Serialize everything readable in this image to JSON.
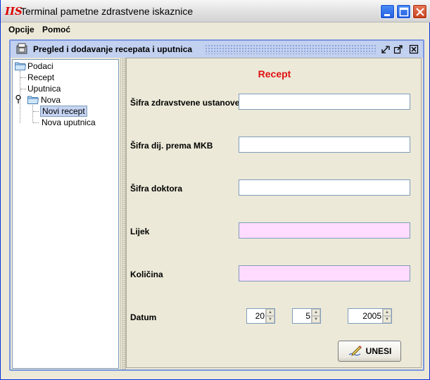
{
  "window": {
    "title": "Terminal pametne zdrastvene iskaznice",
    "app_icon_text": "IIS",
    "controls": [
      "minimize",
      "maximize",
      "close"
    ]
  },
  "menu": {
    "items": [
      "Opcije",
      "Pomoć"
    ]
  },
  "internal_frame": {
    "title": "Pregled i dodavanje recepata i uputnica"
  },
  "tree": {
    "root": "Podaci",
    "items": [
      "Recept",
      "Uputnica"
    ],
    "group": "Nova",
    "group_items": [
      "Novi recept",
      "Nova uputnica"
    ],
    "selected": "Novi recept"
  },
  "form": {
    "title": "Recept",
    "fields": [
      {
        "label": "Šifra zdravstvene ustanove",
        "value": ""
      },
      {
        "label": "Šifra dij. prema MKB",
        "value": ""
      },
      {
        "label": "Šifra doktora",
        "value": ""
      },
      {
        "label": "Lijek",
        "value": ""
      },
      {
        "label": "Količina",
        "value": ""
      }
    ],
    "date": {
      "label": "Datum",
      "day": "20",
      "month": "5",
      "year": "2005"
    },
    "submit_label": "UNESI"
  },
  "colors": {
    "title_red": "#e01010",
    "pink_field": "#ffdcff",
    "selection": "#c6d4f2",
    "frame_blue": "#7a96df"
  }
}
